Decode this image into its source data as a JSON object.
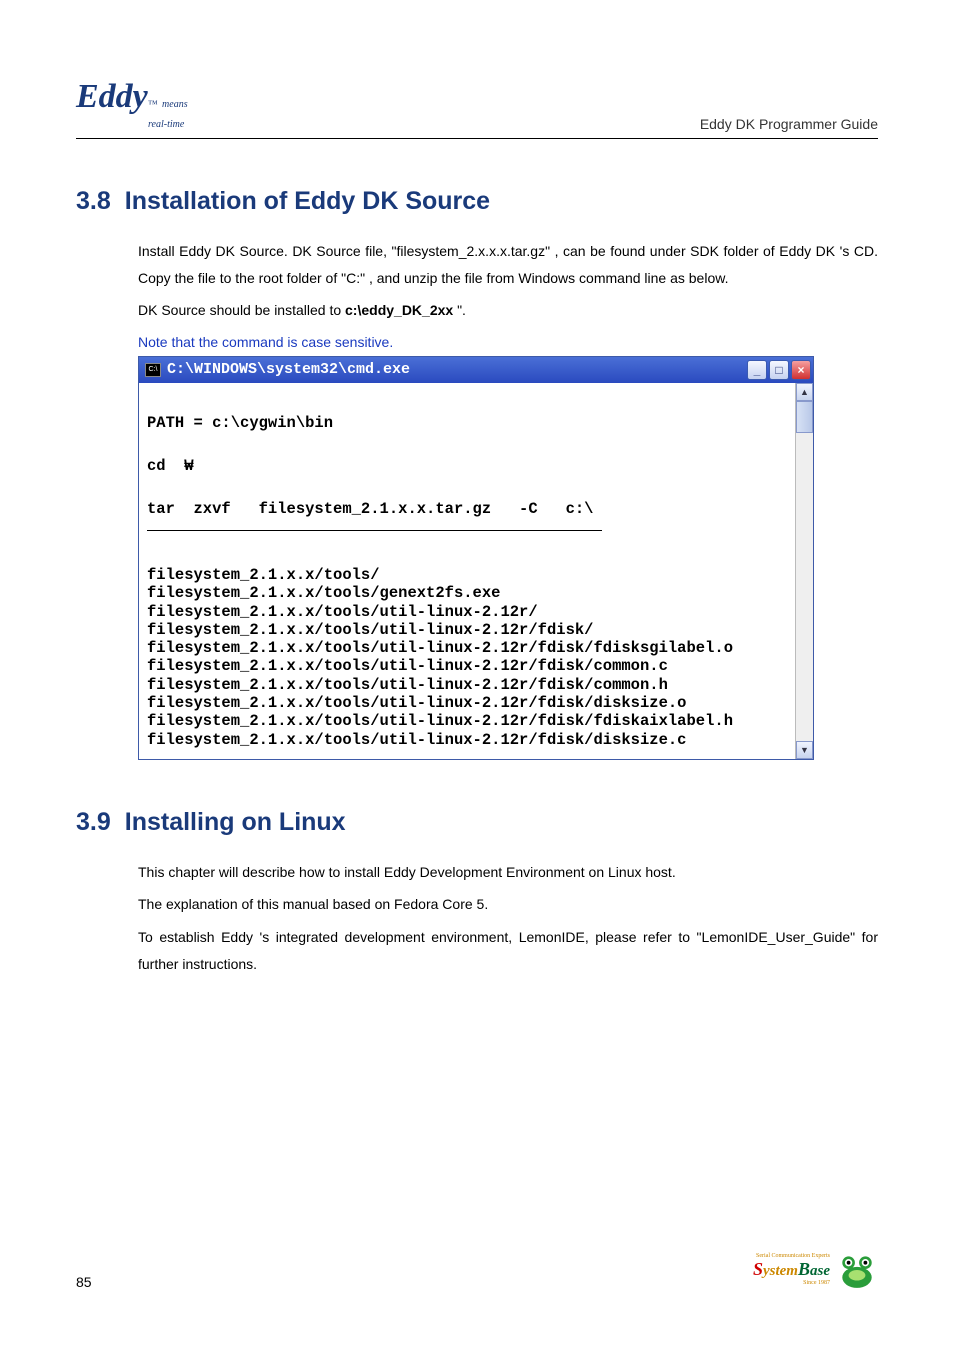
{
  "header": {
    "logo_main": "Eddy",
    "logo_tm": "™",
    "logo_sub1": "means",
    "logo_sub2": "real-time",
    "guide": "Eddy DK Programmer Guide"
  },
  "sec38": {
    "num": "3.8",
    "title": "Installation of Eddy DK Source",
    "p1a": "Install Eddy DK Source.  DK Source file,   \"filesystem_2.x.x.x.tar.gz\"  , can be found under SDK folder of Eddy DK",
    "p1b": "'s CD.   Copy the file to the root folder of    \"C:\"   , and unzip the file from Windows command line as below.",
    "p2a": "DK Source should be installed to ",
    "p2b": "c:\\eddy_DK_2xx",
    "p2c": "  \".",
    "note": "Note that the command is case sensitive."
  },
  "cmd": {
    "title": "C:\\WINDOWS\\system32\\cmd.exe",
    "icon_label": "C:\\",
    "btn_min": "_",
    "btn_max": "□",
    "btn_close": "×",
    "cmd1": "PATH = c:\\cygwin\\bin",
    "cmd2": "cd  ₩",
    "cmd3": "tar  zxvf   filesystem_2.1.x.x.tar.gz   -C   c:\\",
    "out": [
      "filesystem_2.1.x.x/tools/",
      "filesystem_2.1.x.x/tools/genext2fs.exe",
      "filesystem_2.1.x.x/tools/util-linux-2.12r/",
      "filesystem_2.1.x.x/tools/util-linux-2.12r/fdisk/",
      "filesystem_2.1.x.x/tools/util-linux-2.12r/fdisk/fdisksgilabel.o",
      "filesystem_2.1.x.x/tools/util-linux-2.12r/fdisk/common.c",
      "filesystem_2.1.x.x/tools/util-linux-2.12r/fdisk/common.h",
      "filesystem_2.1.x.x/tools/util-linux-2.12r/fdisk/disksize.o",
      "filesystem_2.1.x.x/tools/util-linux-2.12r/fdisk/fdiskaixlabel.h",
      "filesystem_2.1.x.x/tools/util-linux-2.12r/fdisk/disksize.c"
    ],
    "scroll_up": "▲",
    "scroll_down": "▼"
  },
  "sec39": {
    "num": "3.9",
    "title": "Installing on Linux",
    "p1": "This chapter will describe how to install Eddy Development Environment on Linux host.",
    "p2": "The explanation of this manual based on Fedora Core 5.",
    "p3": "To establish Eddy  's integrated development environment, LemonIDE, please refer to   \"LemonIDE_User_Guide\" for further instructions."
  },
  "footer": {
    "page": "85",
    "brand_tag": "Serial Communication Experts",
    "brand_since": "Since 1987",
    "brand": {
      "s": "S",
      "ys": "ystem",
      "b": "B",
      "ase": "ase"
    }
  }
}
